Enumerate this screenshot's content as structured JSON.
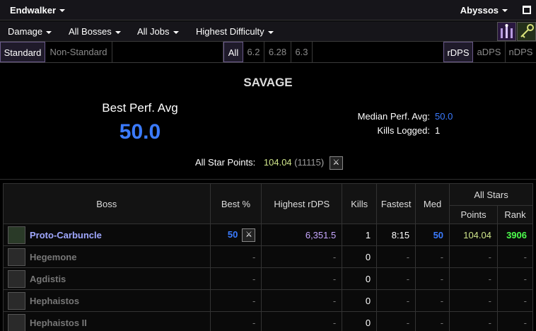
{
  "topbar": {
    "expansion": "Endwalker",
    "server": "Abyssos"
  },
  "menubar": {
    "metric": "Damage",
    "bosses": "All Bosses",
    "jobs": "All Jobs",
    "difficulty": "Highest Difficulty"
  },
  "filters": {
    "standard": "Standard",
    "nonstandard": "Non-Standard",
    "patches": [
      "All",
      "6.2",
      "6.28",
      "6.3"
    ],
    "metrics": [
      "rDPS",
      "aDPS",
      "nDPS"
    ]
  },
  "summary": {
    "difficulty": "SAVAGE",
    "best_perf_label": "Best Perf. Avg",
    "best_perf_value": "50.0",
    "median_label": "Median Perf. Avg:",
    "median_value": "50.0",
    "kills_label": "Kills Logged:",
    "kills_value": "1",
    "all_star_label": "All Star Points:",
    "all_star_points": "104.04",
    "all_star_open": "(",
    "all_star_rank": "11115",
    "all_star_close": ")"
  },
  "table": {
    "headers": {
      "boss": "Boss",
      "best": "Best %",
      "highest": "Highest rDPS",
      "kills": "Kills",
      "fastest": "Fastest",
      "med": "Med",
      "allstars": "All Stars",
      "points": "Points",
      "rank": "Rank"
    },
    "rows": [
      {
        "boss": "Proto-Carbuncle",
        "best": "50",
        "highest": "6,351.5",
        "kills": "1",
        "fastest": "8:15",
        "med": "50",
        "points": "104.04",
        "rank": "3906"
      },
      {
        "boss": "Hegemone",
        "best": "-",
        "highest": "-",
        "kills": "0",
        "fastest": "-",
        "med": "-",
        "points": "-",
        "rank": "-"
      },
      {
        "boss": "Agdistis",
        "best": "-",
        "highest": "-",
        "kills": "0",
        "fastest": "-",
        "med": "-",
        "points": "-",
        "rank": "-"
      },
      {
        "boss": "Hephaistos",
        "best": "-",
        "highest": "-",
        "kills": "0",
        "fastest": "-",
        "med": "-",
        "points": "-",
        "rank": "-"
      },
      {
        "boss": "Hephaistos II",
        "best": "-",
        "highest": "-",
        "kills": "0",
        "fastest": "-",
        "med": "-",
        "points": "-",
        "rank": "-"
      }
    ]
  },
  "colors": {
    "accent_blue": "#3b7bff",
    "points_yellow": "#cfe58a",
    "rank_green": "#4dff4d",
    "boss_purple": "#a0a8ff"
  },
  "icons": {
    "job_icon": "swords-icon",
    "window": "maximize-icon"
  }
}
